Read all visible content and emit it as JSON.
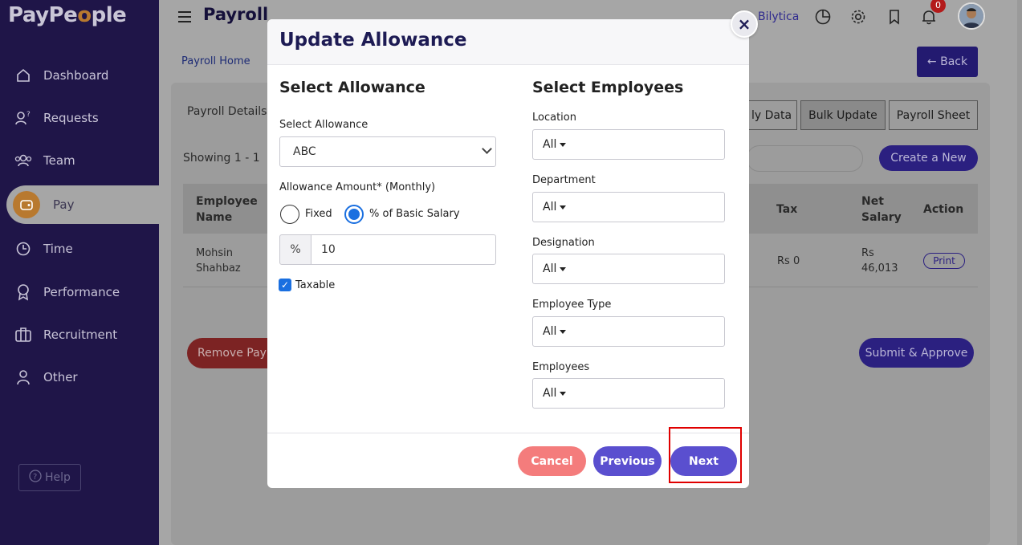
{
  "app": {
    "logo_pre": "PayPe",
    "logo_o": "o",
    "logo_post": "ple"
  },
  "sidebar": {
    "items": [
      {
        "label": "Dashboard",
        "icon": "home-icon"
      },
      {
        "label": "Requests",
        "icon": "requests-icon"
      },
      {
        "label": "Team",
        "icon": "team-icon"
      },
      {
        "label": "Pay",
        "icon": "pay-icon",
        "active": true
      },
      {
        "label": "Time",
        "icon": "clock-icon"
      },
      {
        "label": "Performance",
        "icon": "award-icon"
      },
      {
        "label": "Recruitment",
        "icon": "briefcase-icon"
      },
      {
        "label": "Other",
        "icon": "user-icon"
      }
    ],
    "help": "Help"
  },
  "header": {
    "title": "Payroll",
    "company": "Bilytica",
    "notification_count": "0"
  },
  "background": {
    "breadcrumb": "Payroll Home",
    "back": "Back",
    "details_tab": "Payroll Details",
    "tabs": [
      "ly Data",
      "Bulk Update",
      "Payroll Sheet"
    ],
    "showing": "Showing 1 - 1",
    "create": "Create a New",
    "table": {
      "headers": {
        "employee": "Employee Name",
        "tax": "Tax",
        "net": "Net Salary",
        "action": "Action"
      },
      "row": {
        "employee": "Mohsin Shahbaz",
        "tax": "Rs 0",
        "net": "Rs 46,013",
        "action": "Print"
      }
    },
    "remove": "Remove Payro",
    "submit": "Submit & Approve"
  },
  "modal": {
    "title": "Update Allowance",
    "left": {
      "heading": "Select Allowance",
      "select_label": "Select Allowance",
      "select_value": "ABC",
      "amount_label": "Allowance Amount* (Monthly)",
      "radio_fixed": "Fixed",
      "radio_pct": "% of Basic Salary",
      "radio_selected": "% of Basic Salary",
      "pct_prefix": "%",
      "amount_value": "10",
      "taxable_label": "Taxable",
      "taxable_checked": true
    },
    "right": {
      "heading": "Select Employees",
      "filters": [
        {
          "label": "Location",
          "value": "All"
        },
        {
          "label": "Department",
          "value": "All"
        },
        {
          "label": "Designation",
          "value": "All"
        },
        {
          "label": "Employee Type",
          "value": "All"
        },
        {
          "label": "Employees",
          "value": "All"
        }
      ]
    },
    "buttons": {
      "cancel": "Cancel",
      "previous": "Previous",
      "next": "Next"
    }
  },
  "colors": {
    "sidebar": "#1f1548",
    "accent": "#5a4fcf",
    "cancel": "#f47c7c",
    "highlight": "#e00000",
    "check": "#1a6fe0"
  }
}
